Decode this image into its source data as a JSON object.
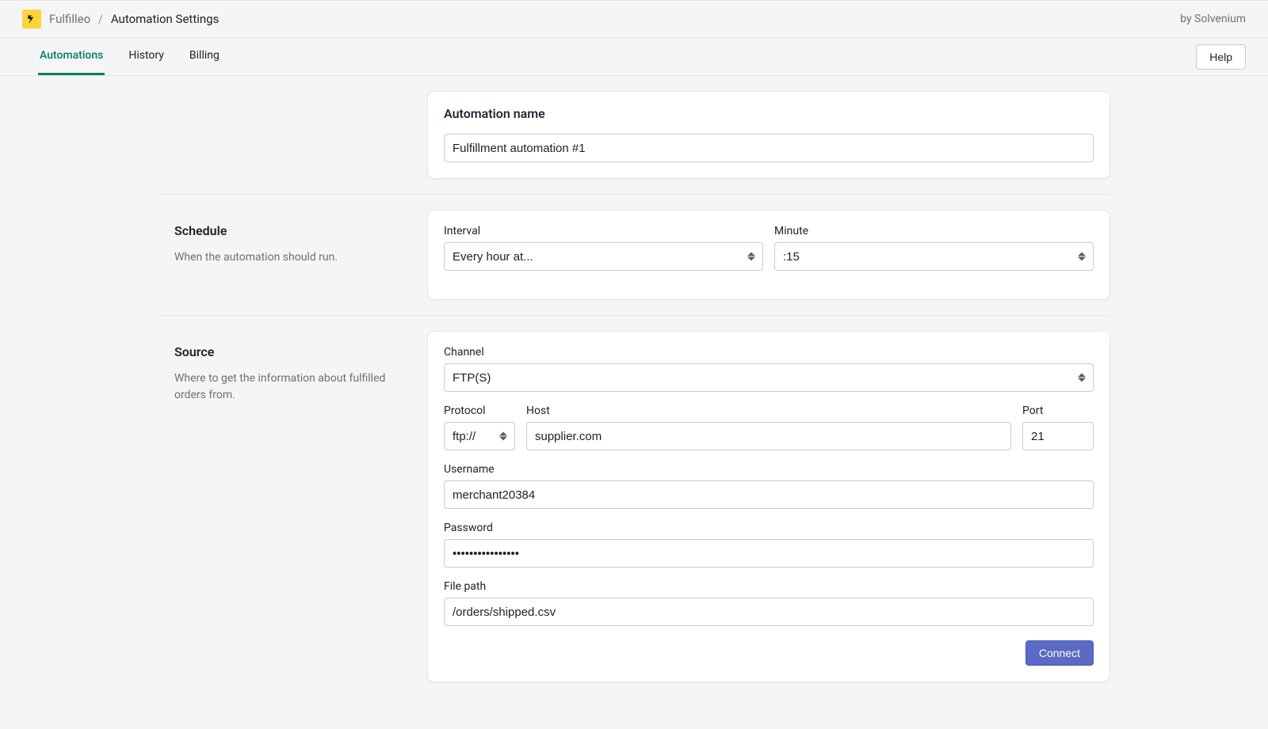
{
  "header": {
    "app_name": "Fulfilleo",
    "page_title": "Automation Settings",
    "vendor": "by Solvenium"
  },
  "tabs": {
    "automations": "Automations",
    "history": "History",
    "billing": "Billing",
    "help": "Help"
  },
  "name_card": {
    "heading": "Automation name",
    "value": "Fulfillment automation #1"
  },
  "schedule": {
    "title": "Schedule",
    "desc": "When the automation should run.",
    "interval_label": "Interval",
    "interval_value": "Every hour at...",
    "minute_label": "Minute",
    "minute_value": ":15"
  },
  "source": {
    "title": "Source",
    "desc": "Where to get the information about fulfilled orders from.",
    "channel_label": "Channel",
    "channel_value": "FTP(S)",
    "protocol_label": "Protocol",
    "protocol_value": "ftp://",
    "host_label": "Host",
    "host_value": "supplier.com",
    "port_label": "Port",
    "port_value": "21",
    "username_label": "Username",
    "username_value": "merchant20384",
    "password_label": "Password",
    "password_value": "••••••••••••••••",
    "filepath_label": "File path",
    "filepath_value": "/orders/shipped.csv",
    "connect": "Connect"
  }
}
